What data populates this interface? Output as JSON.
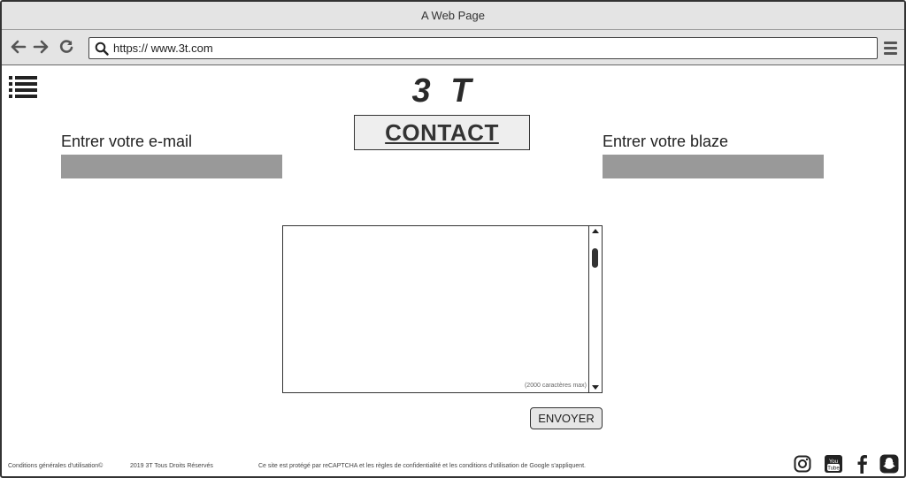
{
  "window": {
    "title": "A Web Page"
  },
  "browser": {
    "url": "https:// www.3t.com",
    "icons": {
      "back": "arrow-left-icon",
      "forward": "arrow-right-icon",
      "reload": "reload-icon",
      "search": "search-icon",
      "menu": "hamburger-menu-icon"
    }
  },
  "page": {
    "menu_icon": "list-icon",
    "logo": "3 T",
    "heading": "CONTACT",
    "email_label": "Entrer votre e-mail",
    "blaze_label": "Entrer votre blaze",
    "message_hint": "(2000 caractères max)",
    "send_label": "ENVOYER"
  },
  "footer": {
    "terms": "Conditions générales d'utilisation©",
    "copyright": "2019 3T Tous Droits Réservés",
    "recaptcha": "Ce site est protégé par reCAPTCHA et les règles de confidentialité et les conditions d'utilisation de Google s'appliquent.",
    "social": [
      "instagram-icon",
      "youtube-icon",
      "facebook-icon",
      "snapchat-icon"
    ]
  },
  "colors": {
    "chrome": "#e4e4e4",
    "input_fill": "#999999",
    "border": "#333333"
  }
}
